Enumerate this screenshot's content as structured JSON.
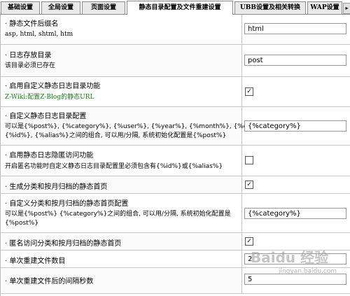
{
  "tabs": [
    {
      "label": "基础设置"
    },
    {
      "label": "全局设置"
    },
    {
      "label": "页面设置"
    },
    {
      "label": "静态目录配置及文件重建设置"
    },
    {
      "label": "UBB设置及相关转换"
    },
    {
      "label": "WAP设置"
    }
  ],
  "rows": [
    {
      "title": "· 静态文件后缀名",
      "desc": "asp, html, shtml, htm",
      "value": "html"
    },
    {
      "title": "· 日志存放目录",
      "desc": "该目录必须已存在",
      "value": "post"
    },
    {
      "title": "· 启用自定义静态日志目录功能",
      "desc": "Z-Wiki:配置Z-Blog的静态URL",
      "checked": "✓"
    },
    {
      "title": "· 自定义静态日志目录配置",
      "desc1": "可以是{%post%}, {%category%}, {%user%}, {%year%}, {%month%}, {%day%},",
      "desc2": "{%id%}, {%alias%}之间的组合, 可以用/分隔, 系统初始化配置是{%post%}",
      "value": "{%category%}"
    },
    {
      "title": "· 启用静态日志隐匿访问功能",
      "desc": "开启匿名功能时自定义静态日志目录配置里必须包含有{%id%}或{%alias%}",
      "checked": ""
    },
    {
      "title": "· 生成分类和按月归档的静态首页",
      "checked": "✓"
    },
    {
      "title": "· 自定义分类和按月归档的静态首页配置",
      "desc1": "可以是{%post%} {%category%}之间的组合, 可以用/分隔, 系统初始化配置是",
      "desc2": "{%post%}",
      "value": "{%category%}"
    },
    {
      "title": "· 匿名访问分类和按月归档的静态首页",
      "checked": "✓"
    },
    {
      "title": "· 单次重建文件数目",
      "value": "2"
    },
    {
      "title": "· 单次重建文件后的间隔秒数",
      "value": "5"
    }
  ],
  "watermark": {
    "text": "Baidu 经验",
    "sub": "jingyan.baidu.com"
  }
}
